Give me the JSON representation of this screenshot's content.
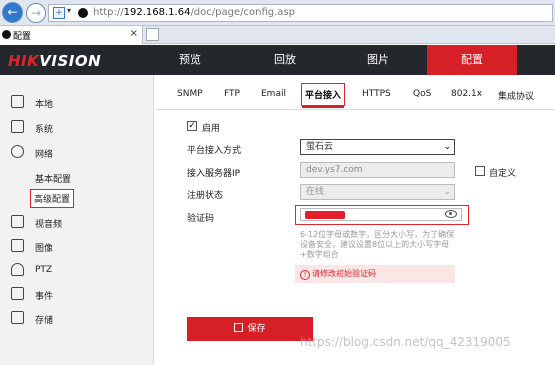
{
  "browser": {
    "url_prefix": "http://",
    "url_host": "192.168.1.64",
    "url_path": "/doc/page/config.asp",
    "tab_title": "配置"
  },
  "brand": {
    "logo_part1": "HIK",
    "logo_part2": "VISION"
  },
  "main_nav": [
    "预览",
    "回放",
    "图片",
    "配置"
  ],
  "sidebar": {
    "items": [
      "本地",
      "系统",
      "网络"
    ],
    "network_sub": [
      "基本配置",
      "高级配置"
    ],
    "items2": [
      "视音频",
      "图像",
      "PTZ",
      "事件",
      "存储"
    ]
  },
  "sub_tabs": [
    "SNMP",
    "FTP",
    "Email",
    "平台接入",
    "HTTPS",
    "QoS",
    "802.1x",
    "集成协议"
  ],
  "form": {
    "enable_label": "启用",
    "enable_checked": true,
    "access_mode_label": "平台接入方式",
    "access_mode_value": "萤石云",
    "server_ip_label": "接入服务器IP",
    "server_ip_value": "dev.ys7.com",
    "custom_label": "自定义",
    "register_status_label": "注册状态",
    "register_status_value": "在线",
    "verify_code_label": "验证码",
    "hint": "6-12位字母或数字，区分大小写，为了确保设备安全，建议设置8位以上的大小写字母+数字组合",
    "warning": "请修改初始验证码",
    "save_label": "保存"
  },
  "watermark": "https://blog.csdn.net/qq_42319005",
  "colors": {
    "brand_red": "#d61f27",
    "header_dark": "#24272c"
  }
}
